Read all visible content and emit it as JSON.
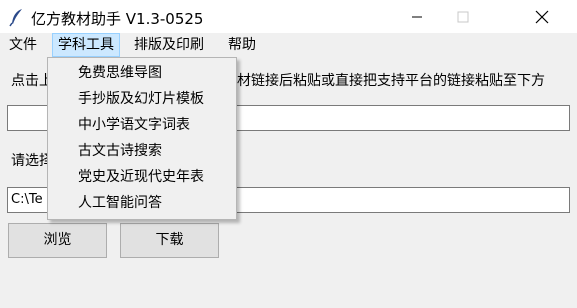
{
  "window": {
    "title": "亿方教材助手 V1.3-0525",
    "icon": "feather-icon",
    "controls": {
      "minimize": "minimize-icon",
      "maximize": "maximize-icon",
      "close": "close-icon"
    }
  },
  "menubar": {
    "items": [
      {
        "label": "文件"
      },
      {
        "label": "学科工具"
      },
      {
        "label": "排版及印刷"
      },
      {
        "label": "帮助"
      }
    ]
  },
  "submenu": {
    "items": [
      {
        "label": "免费思维导图"
      },
      {
        "label": "手抄版及幻灯片模板"
      },
      {
        "label": "中小学语文字词表"
      },
      {
        "label": "古文古诗搜索"
      },
      {
        "label": "党史及近现代史年表"
      },
      {
        "label": "人工智能问答"
      }
    ]
  },
  "main": {
    "instruction_visible_start": "点击上",
    "instruction_visible_end": "材链接后粘贴或直接把支持平台的链接粘贴至下方",
    "link_input_value": "",
    "path_label_visible": "请选择",
    "path_input_value_visible": "C:\\Te",
    "browse_label": "浏览",
    "download_label": "下载"
  },
  "colors": {
    "menu_highlight_bg": "#cce8ff",
    "menu_highlight_border": "#99d1ff",
    "button_bg": "#e1e1e1"
  }
}
